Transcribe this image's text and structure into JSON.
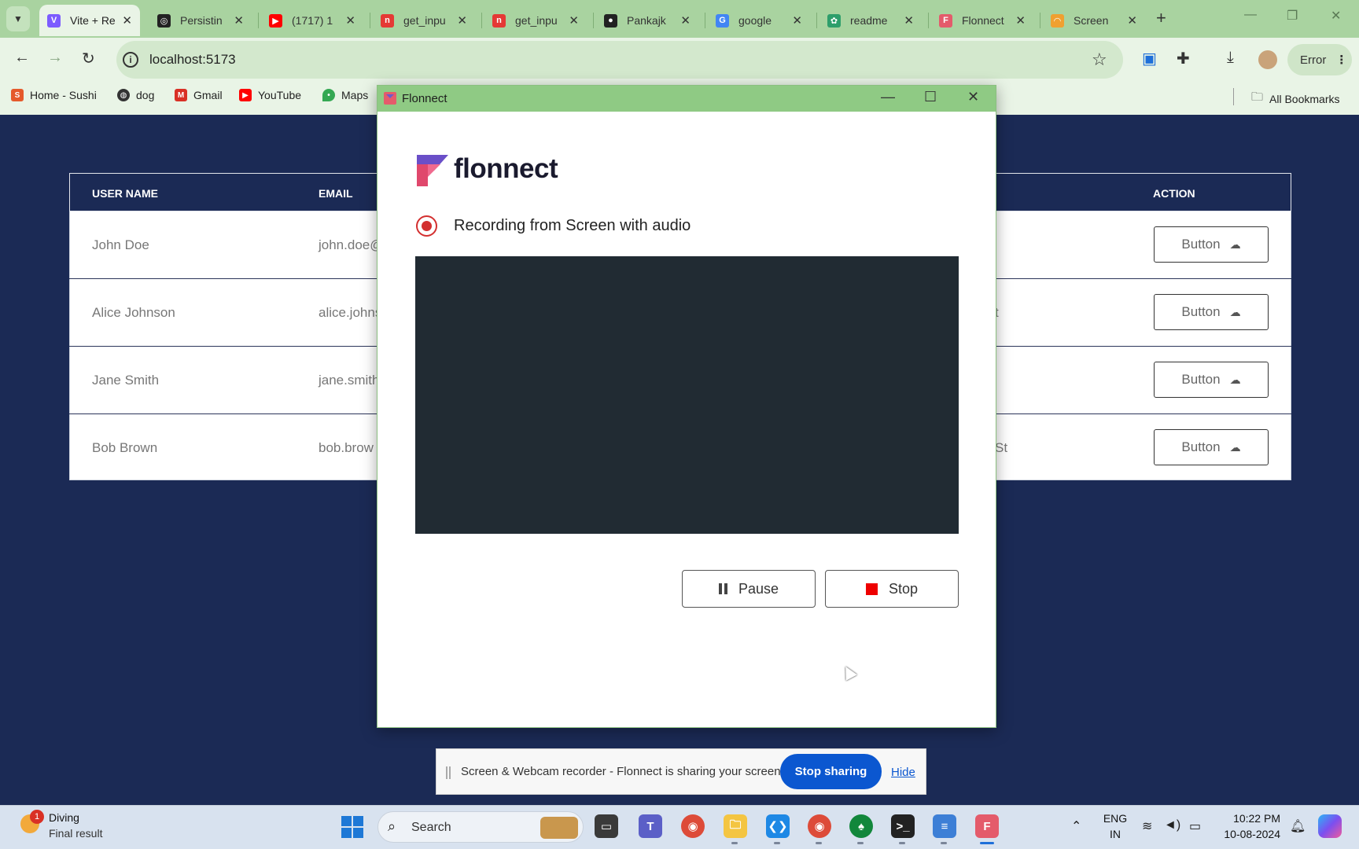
{
  "browser": {
    "tabs": [
      {
        "title": "Vite + Re",
        "active": true,
        "icon": "vite-icon",
        "color": "#7c5cff"
      },
      {
        "title": "Persistin",
        "active": false,
        "icon": "chatgpt-icon",
        "color": "#222222"
      },
      {
        "title": "(1717) 1",
        "active": false,
        "icon": "youtube-icon",
        "color": "#ff0000"
      },
      {
        "title": "get_inpu",
        "active": false,
        "icon": "n-icon",
        "color": "#e53935"
      },
      {
        "title": "get_inpu",
        "active": false,
        "icon": "n-icon",
        "color": "#e53935"
      },
      {
        "title": "Pankajk",
        "active": false,
        "icon": "github-icon",
        "color": "#222222"
      },
      {
        "title": "google",
        "active": false,
        "icon": "google-icon",
        "color": "#4285f4"
      },
      {
        "title": "readme",
        "active": false,
        "icon": "app-icon",
        "color": "#2e9e6b"
      },
      {
        "title": "Flonnect",
        "active": false,
        "icon": "flonnect-icon",
        "color": "#e45b6b"
      },
      {
        "title": "Screen",
        "active": false,
        "icon": "rainbow-icon",
        "color": "#f0a030"
      }
    ],
    "url": "localhost:5173",
    "profile_status": "Error",
    "bookmarks": [
      {
        "label": "Home - Sushi",
        "icon": "sushi-icon",
        "color": "#e55a2b"
      },
      {
        "label": "dog",
        "icon": "globe-icon",
        "color": "#333333"
      },
      {
        "label": "Gmail",
        "icon": "gmail-icon",
        "color": "#d93025"
      },
      {
        "label": "YouTube",
        "icon": "youtube-icon",
        "color": "#ff0000"
      },
      {
        "label": "Maps",
        "icon": "maps-icon",
        "color": "#34a853"
      }
    ],
    "all_bookmarks": "All Bookmarks"
  },
  "table": {
    "headers": {
      "user_name": "USER NAME",
      "email": "EMAIL",
      "action": "ACTION"
    },
    "rows": [
      {
        "name": "John Doe",
        "email": "john.doe@",
        "address": "",
        "button": "Button"
      },
      {
        "name": "Alice Johnson",
        "email": "alice.johns",
        "address": "t",
        "button": "Button"
      },
      {
        "name": "Jane Smith",
        "email": "jane.smith",
        "address": "",
        "button": "Button"
      },
      {
        "name": "Bob Brown",
        "email": "bob.brow",
        "address": "St",
        "button": "Button"
      }
    ]
  },
  "flonnect": {
    "window_title": "Flonnect",
    "brand": "flonnect",
    "status": "Recording from Screen with audio",
    "pause": "Pause",
    "stop": "Stop"
  },
  "sharebar": {
    "message": "Screen & Webcam recorder - Flonnect is sharing your screen.",
    "stop_sharing": "Stop sharing",
    "hide": "Hide"
  },
  "taskbar": {
    "weather_title": "Diving",
    "weather_sub": "Final result",
    "weather_badge": "1",
    "search": "Search",
    "lang_1": "ENG",
    "lang_2": "IN",
    "time": "10:22 PM",
    "date": "10-08-2024"
  },
  "colors": {
    "page_bg": "#1b2a55",
    "chrome_green": "#a9d3a0",
    "accent_blue": "#0b57d0",
    "record_red": "#d32f2f"
  }
}
